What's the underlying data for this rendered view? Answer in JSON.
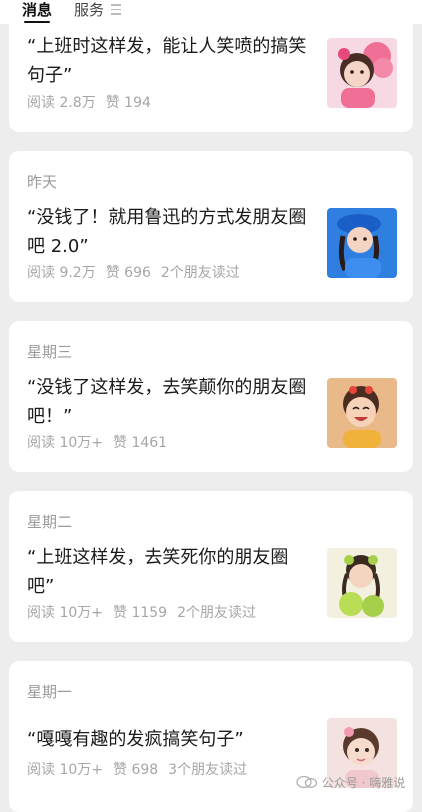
{
  "tabs": {
    "messages": "消息",
    "services": "服务"
  },
  "cards": [
    {
      "day": "",
      "title": "“上班时这样发，能让人笑喷的搞笑句子”",
      "reads": "阅读 2.8万",
      "likes": "赞 194",
      "friends": ""
    },
    {
      "day": "昨天",
      "title": "“没钱了！就用鲁迅的方式发朋友圈吧 2.0”",
      "reads": "阅读 9.2万",
      "likes": "赞 696",
      "friends": "2个朋友读过"
    },
    {
      "day": "星期三",
      "title": "“没钱了这样发，去笑颠你的朋友圈吧！”",
      "reads": "阅读 10万+",
      "likes": "赞 1461",
      "friends": ""
    },
    {
      "day": "星期二",
      "title": "“上班这样发，去笑死你的朋友圈吧”",
      "reads": "阅读 10万+",
      "likes": "赞 1159",
      "friends": "2个朋友读过"
    },
    {
      "day": "星期一",
      "title": "“嘎嘎有趣的发疯搞笑句子”",
      "reads": "阅读 10万+",
      "likes": "赞 698",
      "friends": "3个朋友读过"
    }
  ],
  "thumbnails": [
    "girl-pink-balloon-thumbnail",
    "girl-blue-hat-thumbnail",
    "girl-laughing-thumbnail",
    "girl-green-fruit-thumbnail",
    "girl-pink-flower-thumbnail"
  ],
  "watermark": "公众号 · 嗨雅说",
  "colors": {
    "background": "#ededed",
    "card": "#ffffff",
    "title": "#1a1a1a",
    "meta": "#a6a6a6"
  }
}
